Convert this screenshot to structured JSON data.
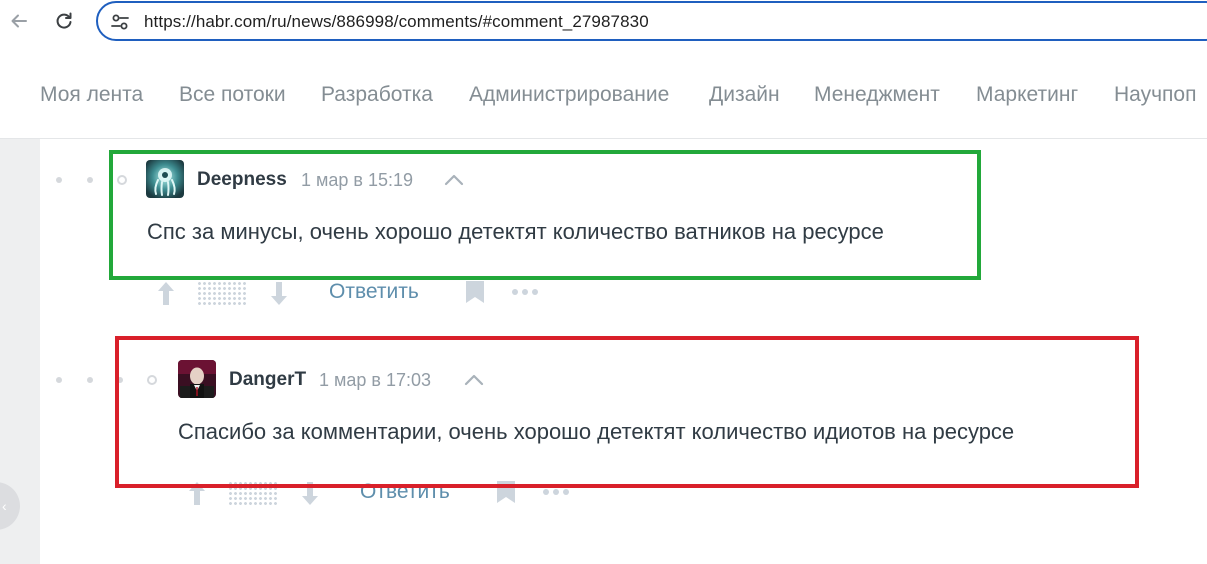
{
  "browser": {
    "url": "https://habr.com/ru/news/886998/comments/#comment_27987830"
  },
  "nav": {
    "items": [
      "Моя лента",
      "Все потоки",
      "Разработка",
      "Администрирование",
      "Дизайн",
      "Менеджмент",
      "Маркетинг",
      "Научпоп"
    ]
  },
  "comments": [
    {
      "username": "Deepness",
      "time": "1 мар в 15:19",
      "text": "Спс за минусы, очень хорошо детектят количество ватников на ресурсе",
      "reply_label": "Ответить",
      "highlight_color": "#22a83a"
    },
    {
      "username": "DangerT",
      "time": "1 мар в 17:03",
      "text": "Спасибо за комментарии, очень хорошо детектят количество идиотов на ресурсе",
      "reply_label": "Ответить",
      "highlight_color": "#d9202a"
    }
  ],
  "icons": {
    "back": "arrow-left-icon",
    "reload": "reload-icon",
    "site_settings": "tune-icon",
    "collapse": "chevron-up-icon",
    "upvote": "arrow-up-icon",
    "downvote": "arrow-down-icon",
    "bookmark": "bookmark-icon",
    "more": "more-dots-icon"
  }
}
